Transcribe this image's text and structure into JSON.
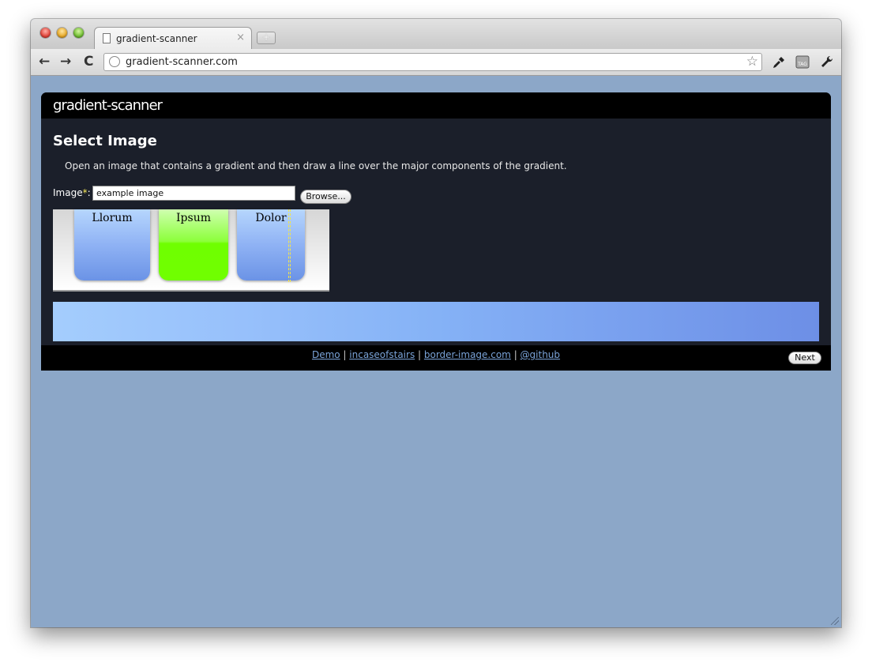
{
  "browser": {
    "tab_title": "gradient-scanner",
    "tab_close": "×",
    "new_tab": "+",
    "url": "gradient-scanner.com",
    "back": "←",
    "forward": "→",
    "reload": "C",
    "bookmark_star": "☆"
  },
  "app": {
    "brand": "gradient-scanner",
    "section_title": "Select Image",
    "intro": "Open an image that contains a gradient and then draw a line over the major components of the gradient.",
    "image_label": "Image",
    "required_marker": "*",
    "image_label_colon": ":",
    "image_value": "example image",
    "browse_label": "Browse...",
    "preview_boxes": [
      {
        "label": "Llorum",
        "style": "blue"
      },
      {
        "label": "Ipsum",
        "style": "green"
      },
      {
        "label": "Dolor",
        "style": "blue"
      }
    ],
    "gradient_colors": [
      "#a4cdfd",
      "#85b2f6",
      "#6d8fe6"
    ]
  },
  "footer": {
    "links": [
      {
        "label": "Demo"
      },
      {
        "label": "incaseofstairs"
      },
      {
        "label": "border-image.com"
      },
      {
        "label": "@github"
      }
    ],
    "separator": " | ",
    "next_label": "Next"
  }
}
